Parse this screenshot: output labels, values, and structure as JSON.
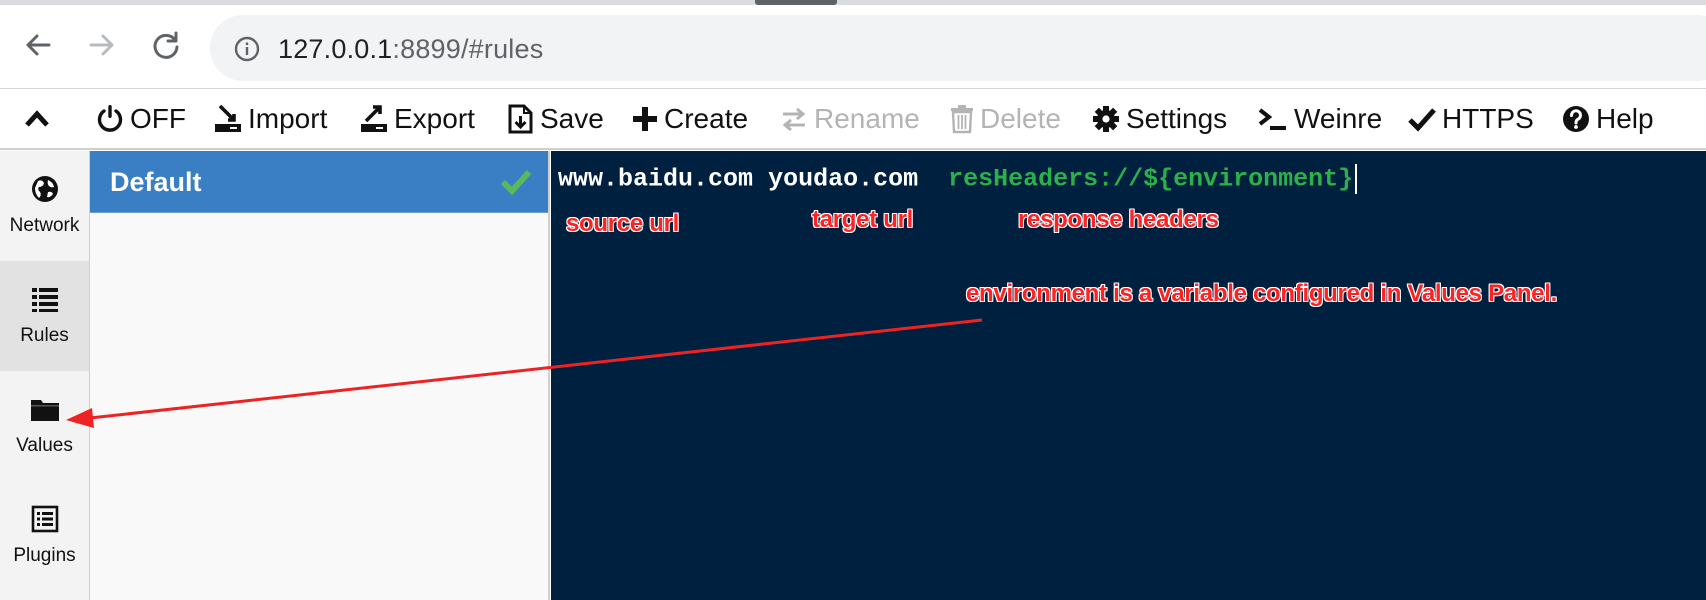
{
  "browser": {
    "url_host": "127.0.0.1",
    "url_rest": ":8899/#rules"
  },
  "toolbar": {
    "off_label": "OFF",
    "import_label": "Import",
    "export_label": "Export",
    "save_label": "Save",
    "create_label": "Create",
    "rename_label": "Rename",
    "delete_label": "Delete",
    "settings_label": "Settings",
    "weinre_label": "Weinre",
    "https_label": "HTTPS",
    "help_label": "Help",
    "disabled_color": "#b4b4b4"
  },
  "sidebar": {
    "items": [
      {
        "label": "Network",
        "icon": "globe-icon"
      },
      {
        "label": "Rules",
        "icon": "list-icon",
        "active": true
      },
      {
        "label": "Values",
        "icon": "folder-icon"
      },
      {
        "label": "Plugins",
        "icon": "plugin-list-icon"
      }
    ]
  },
  "rules": {
    "items": [
      {
        "name": "Default",
        "selected": true,
        "enabled": true
      }
    ],
    "selected_color": "#3a7fc4",
    "check_color": "#5cb85c"
  },
  "editor": {
    "source": "www.baidu.com",
    "target": "youdao.com",
    "protocol_value": "resHeaders://${environment}",
    "background": "#002040",
    "keyword_color": "#2bb14a"
  },
  "annotations": {
    "source_url": "source url",
    "target_url": "target url",
    "response_headers": "response headers",
    "environment_note": "environment is a variable configured in Values Panel.",
    "color": "#ff2222"
  }
}
